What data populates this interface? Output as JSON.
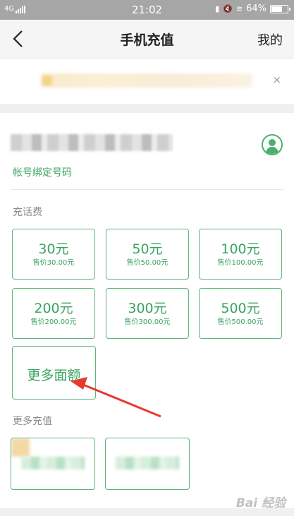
{
  "status_bar": {
    "network": "4G",
    "time": "21:02",
    "battery_text": "64%",
    "battery_level": 0.64
  },
  "nav": {
    "back_icon": "chevron-left-icon",
    "title": "手机充值",
    "right_label": "我的"
  },
  "banner": {
    "close_icon": "close-icon",
    "close_label": "×"
  },
  "account": {
    "bind_label": "帐号绑定号码",
    "avatar_icon": "user-avatar-icon"
  },
  "recharge": {
    "title": "充话费",
    "options": [
      {
        "amount": "30元",
        "price": "售价30.00元"
      },
      {
        "amount": "50元",
        "price": "售价50.00元"
      },
      {
        "amount": "100元",
        "price": "售价100.00元"
      },
      {
        "amount": "200元",
        "price": "售价200.00元"
      },
      {
        "amount": "300元",
        "price": "售价300.00元"
      },
      {
        "amount": "500元",
        "price": "售价500.00元"
      }
    ],
    "more_amounts": "更多面额"
  },
  "more": {
    "title": "更多充值"
  },
  "watermark": "Bai 经验",
  "colors": {
    "accent": "#3aa360",
    "border": "#5cb57a",
    "arrow": "#e8392d"
  }
}
